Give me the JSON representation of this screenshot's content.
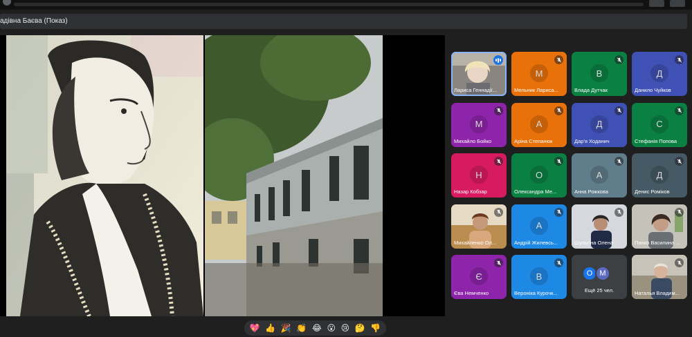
{
  "header": {
    "presenter_title": "адівна Баєва (Показ)"
  },
  "participants": [
    {
      "name": "Лариса Геннадії...",
      "initial": "",
      "color": "#6f6f6f",
      "type": "video-woman1",
      "speaking": true
    },
    {
      "name": "Мельник Лариса...",
      "initial": "М",
      "color": "#e8710a",
      "type": "avatar"
    },
    {
      "name": "Влада Дутчак",
      "initial": "В",
      "color": "#0b8043",
      "type": "avatar"
    },
    {
      "name": "Данило Чуйков",
      "initial": "Д",
      "color": "#3f51b5",
      "type": "avatar"
    },
    {
      "name": "Михайло Бойко",
      "initial": "М",
      "color": "#8e24aa",
      "type": "avatar"
    },
    {
      "name": "Аріна Степанюк",
      "initial": "А",
      "color": "#e8710a",
      "type": "avatar"
    },
    {
      "name": "Дар'я Ходанич",
      "initial": "Д",
      "color": "#3f51b5",
      "type": "avatar"
    },
    {
      "name": "Стефанія Попова",
      "initial": "С",
      "color": "#0b8043",
      "type": "avatar"
    },
    {
      "name": "Назар Кобзар",
      "initial": "Н",
      "color": "#d81b60",
      "type": "avatar"
    },
    {
      "name": "Олександра Ме...",
      "initial": "О",
      "color": "#0b8043",
      "type": "avatar"
    },
    {
      "name": "Анна Рожкова",
      "initial": "А",
      "color": "#607d8b",
      "type": "avatar"
    },
    {
      "name": "Денис Роміков",
      "initial": "Д",
      "color": "#455a64",
      "type": "avatar"
    },
    {
      "name": "Михайленко Ол...",
      "initial": "",
      "color": "#8a6a40",
      "type": "video-woman2"
    },
    {
      "name": "Андрій Жилевсь...",
      "initial": "А",
      "color": "#1e88e5",
      "type": "avatar"
    },
    {
      "name": "Шульгіна Олена",
      "initial": "",
      "color": "#c9cdd2",
      "type": "video-woman3"
    },
    {
      "name": "Панко Василина ...",
      "initial": "",
      "color": "#9a9b95",
      "type": "video-woman4"
    },
    {
      "name": "Єва Немченко",
      "initial": "Є",
      "color": "#8e24aa",
      "type": "avatar"
    },
    {
      "name": "Вероніка Курочк...",
      "initial": "В",
      "color": "#1e88e5",
      "type": "avatar"
    },
    {
      "name": "Ещё 25 чел.",
      "initial": "",
      "color": "#3c4043",
      "type": "more",
      "more_initials": [
        "О",
        "М"
      ],
      "more_colors": [
        "#1a73e8",
        "#5c6bc0"
      ]
    },
    {
      "name": "Наталья Владим...",
      "initial": "",
      "color": "#b0a89a",
      "type": "video-man"
    }
  ],
  "reactions": [
    "💖",
    "👍",
    "🎉",
    "👏",
    "😂",
    "😮",
    "😢",
    "🤔",
    "👎"
  ],
  "colors": {
    "background": "#1f1f1f",
    "accent": "#8ab4f8",
    "speaking": "#1a73e8"
  }
}
